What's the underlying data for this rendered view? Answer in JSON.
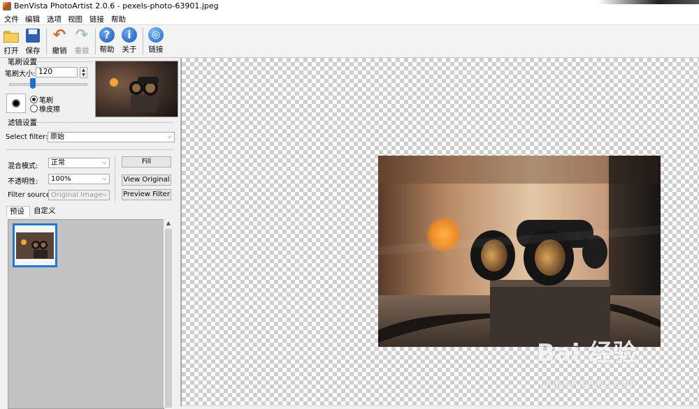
{
  "window": {
    "title": "BenVista PhotoArtist 2.0.6 - pexels-photo-63901.jpeg"
  },
  "menu": [
    "文件",
    "编辑",
    "选项",
    "视图",
    "链接",
    "帮助"
  ],
  "toolbar": {
    "open": "打开",
    "save": "保存",
    "undo": "撤销",
    "redo": "重做",
    "help": "帮助",
    "about": "关于",
    "link": "链接",
    "help_glyph": "?",
    "about_glyph": "i"
  },
  "brush": {
    "section_title": "笔刷设置",
    "size_label": "笔刷大小:",
    "size_value": "120",
    "size_level": 0.3,
    "mode_brush": "笔刷",
    "mode_eraser": "橡皮擦",
    "selected_mode": "笔刷"
  },
  "filter": {
    "section_title": "滤镜设置",
    "select_label": "Select filter:",
    "select_value": "原始",
    "blend_label": "混合模式:",
    "blend_value": "正常",
    "opacity_label": "不透明性:",
    "opacity_value": "100%",
    "source_label": "Filter source:",
    "source_value": "Original Image",
    "fill_button": "Fill",
    "view_original_button": "View Original",
    "preview_filter_button": "Preview Filter"
  },
  "tabs": [
    "预设",
    "自定义"
  ],
  "watermark": {
    "logo": "Bai 经验",
    "url": "jingyan.baidu.com"
  },
  "colors": {
    "accent": "#1f78d2",
    "panel": "#f0f0f0"
  }
}
